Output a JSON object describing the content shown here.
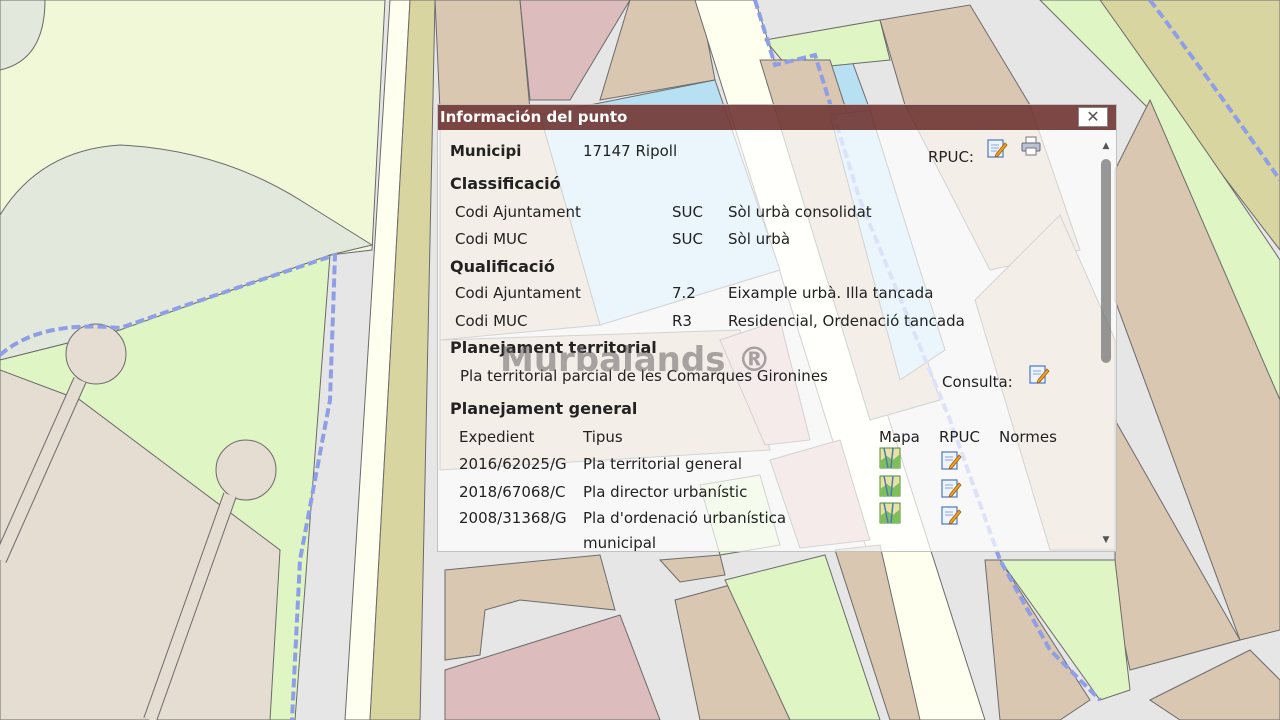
{
  "popup": {
    "title": "Información del punto",
    "close_symbol": "✕",
    "municipi_label": "Municipi",
    "municipi_value": "17147 Ripoll",
    "rpuc_label": "RPUC:",
    "classificacio": {
      "heading": "Classificació",
      "rows": [
        {
          "label": "Codi Ajuntament",
          "code": "SUC",
          "desc": "Sòl urbà consolidat"
        },
        {
          "label": "Codi MUC",
          "code": "SUC",
          "desc": "Sòl urbà"
        }
      ]
    },
    "qualificacio": {
      "heading": "Qualificació",
      "rows": [
        {
          "label": "Codi Ajuntament",
          "code": "7.2",
          "desc": "Eixample urbà. Illa tancada"
        },
        {
          "label": "Codi MUC",
          "code": "R3",
          "desc": "Residencial, Ordenació tancada"
        }
      ]
    },
    "territorial": {
      "heading": "Planejament territorial",
      "plan": "Pla territorial parcial de les Comarques Gironines",
      "consulta_label": "Consulta:"
    },
    "general": {
      "heading": "Planejament general",
      "columns": {
        "expedient": "Expedient",
        "tipus": "Tipus",
        "mapa": "Mapa",
        "rpuc": "RPUC",
        "normes": "Normes"
      },
      "rows": [
        {
          "expedient": "2016/62025/G",
          "tipus": "Pla territorial general"
        },
        {
          "expedient": "2018/67068/C",
          "tipus": "Pla director urbanístic"
        },
        {
          "expedient": "2008/31368/G",
          "tipus": "Pla d'ordenació urbanística",
          "tipus_cont": "municipal"
        }
      ]
    },
    "icons": {
      "edit": "edit-document-icon",
      "print": "printer-icon",
      "map": "map-icon"
    }
  },
  "watermark": "Murbalands ®",
  "colors": {
    "header": "#60201c",
    "map_green": "#e3f5c8",
    "map_tan": "#d9c7b1",
    "map_pink": "#dcbcbc",
    "map_blue": "#b7e1f2",
    "boundary": "#8f9fe6"
  }
}
